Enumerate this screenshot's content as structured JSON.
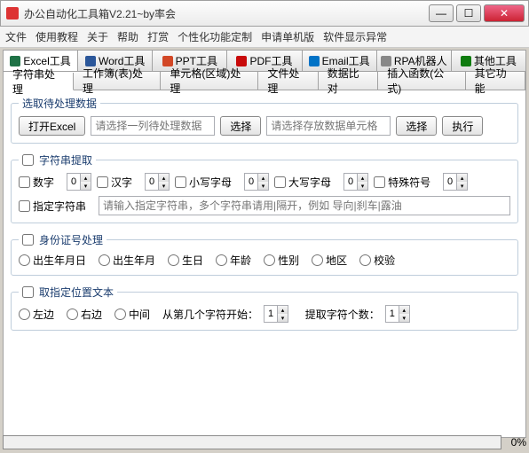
{
  "window": {
    "title": "办公自动化工具箱V2.21~by率会"
  },
  "menus": [
    "文件",
    "使用教程",
    "关于",
    "帮助",
    "打赏",
    "个性化功能定制",
    "申请单机版",
    "软件显示异常"
  ],
  "tabs": [
    {
      "label": "Excel工具"
    },
    {
      "label": "Word工具"
    },
    {
      "label": "PPT工具"
    },
    {
      "label": "PDF工具"
    },
    {
      "label": "Email工具"
    },
    {
      "label": "RPA机器人"
    },
    {
      "label": "其他工具"
    }
  ],
  "subtabs": [
    "字符串处理",
    "工作簿(表)处理",
    "单元格(区域)处理",
    "文件处理",
    "数据比对",
    "插入函数(公式)",
    "其它功能"
  ],
  "section_select": {
    "legend": "选取待处理数据",
    "open_btn": "打开Excel",
    "ph_col": "请选择一列待处理数据",
    "select_btn": "选择",
    "ph_cell": "请选择存放数据单元格",
    "exec_btn": "执行"
  },
  "section_extract": {
    "legend": "字符串提取",
    "num": "数字",
    "cn": "汉字",
    "lower": "小写字母",
    "upper": "大写字母",
    "special": "特殊符号",
    "custom": "指定字符串",
    "custom_ph": "请输入指定字符串，多个字符串请用|隔开，例如 导向|刹车|露油",
    "spin": "0"
  },
  "section_id": {
    "legend": "身份证号处理",
    "opts": [
      "出生年月日",
      "出生年月",
      "生日",
      "年龄",
      "性别",
      "地区",
      "校验"
    ]
  },
  "section_pos": {
    "legend": "取指定位置文本",
    "left": "左边",
    "right": "右边",
    "mid": "中间",
    "from_label": "从第几个字符开始：",
    "count_label": "提取字符个数：",
    "spin": "1"
  },
  "progress": {
    "pct": "0%"
  }
}
